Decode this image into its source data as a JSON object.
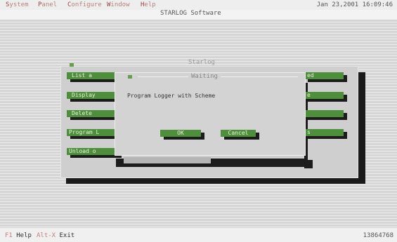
{
  "menubar": {
    "items": [
      {
        "hot": "S",
        "rest": "ystem"
      },
      {
        "hot": "P",
        "rest": "anel"
      },
      {
        "hot": "C",
        "rest": "onfigure"
      },
      {
        "hot": "W",
        "rest": "indow"
      },
      {
        "hot": "H",
        "rest": "elp"
      }
    ],
    "clock": "Jan 23,2001 16:09:46"
  },
  "app_title": "STARLOG Software",
  "main_panel": {
    "title": "Starlog",
    "left_buttons": [
      "List a",
      "Display",
      "Delete",
      "Program L",
      "Unload o"
    ],
    "right_buttons": [
      "ed",
      "e",
      "",
      "s"
    ]
  },
  "dialog": {
    "title": "Waiting",
    "message": "Program Logger with Scheme",
    "ok_label": "OK",
    "cancel_label": "Cancel"
  },
  "statusbar": {
    "help_key": "F1",
    "help_label": "Help",
    "exit_key": "Alt-X",
    "exit_label": "Exit",
    "memory": "13864768"
  },
  "colors": {
    "button_green": "#4e8f3c",
    "button_text": "#e6f2d8",
    "shadow": "#1c1c1c",
    "menu_hotkey": "#a04040",
    "background": "#d5d5d5"
  }
}
